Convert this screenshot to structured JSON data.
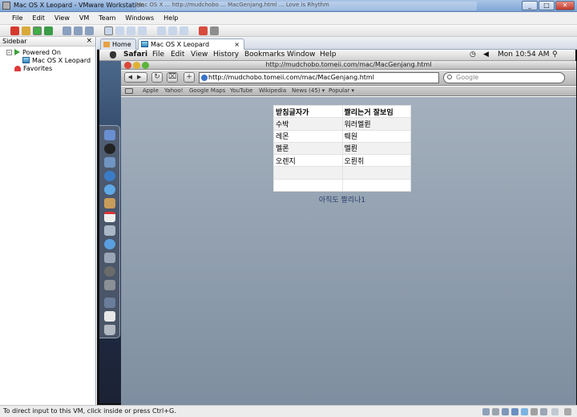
{
  "window": {
    "title": "Mac OS X Leopard - VMware Workstation",
    "background_tasks": "Mac OS X ... http://mudchobo ... MacGenjang.html ... Love is Rhythm"
  },
  "vmware_menu": [
    "File",
    "Edit",
    "View",
    "VM",
    "Team",
    "Windows",
    "Help"
  ],
  "sidebar": {
    "title": "Sidebar",
    "close": "×",
    "powered_on": "Powered On",
    "vm_name": "Mac OS X Leopard",
    "favorites": "Favorites"
  },
  "tabs": [
    {
      "label": "Home"
    },
    {
      "label": "Mac OS X Leopard",
      "close": "×"
    }
  ],
  "mac_menubar": {
    "items": [
      "Safari",
      "File",
      "Edit",
      "View",
      "History",
      "Bookmarks",
      "Window",
      "Help"
    ],
    "clock": "Mon 10:54 AM"
  },
  "safari": {
    "window_title": "http://mudchobo.tomeii.com/mac/MacGenjang.html",
    "url": "http://mudchobo.tomeii.com/mac/MacGenjang.html",
    "search_placeholder": "Google",
    "add_button": "+",
    "bookmarks": [
      "Apple",
      "Yahoo!",
      "Google Maps",
      "YouTube",
      "Wikipedia",
      "News (45) ▾",
      "Popular ▾"
    ]
  },
  "page": {
    "table": {
      "headers": [
        "받침글자가",
        "짤리는거 잘보임"
      ],
      "rows": [
        [
          "수박",
          "워러멜륀"
        ],
        [
          "레몬",
          "뤠원"
        ],
        [
          "멜론",
          "멜륀"
        ],
        [
          "오렌지",
          "오륀쥐"
        ],
        [
          "",
          ""
        ],
        [
          "",
          ""
        ]
      ]
    },
    "caption": "아직도 짤리나1"
  },
  "status_bar": {
    "text": "To direct input to this VM, click inside or press Ctrl+G."
  }
}
